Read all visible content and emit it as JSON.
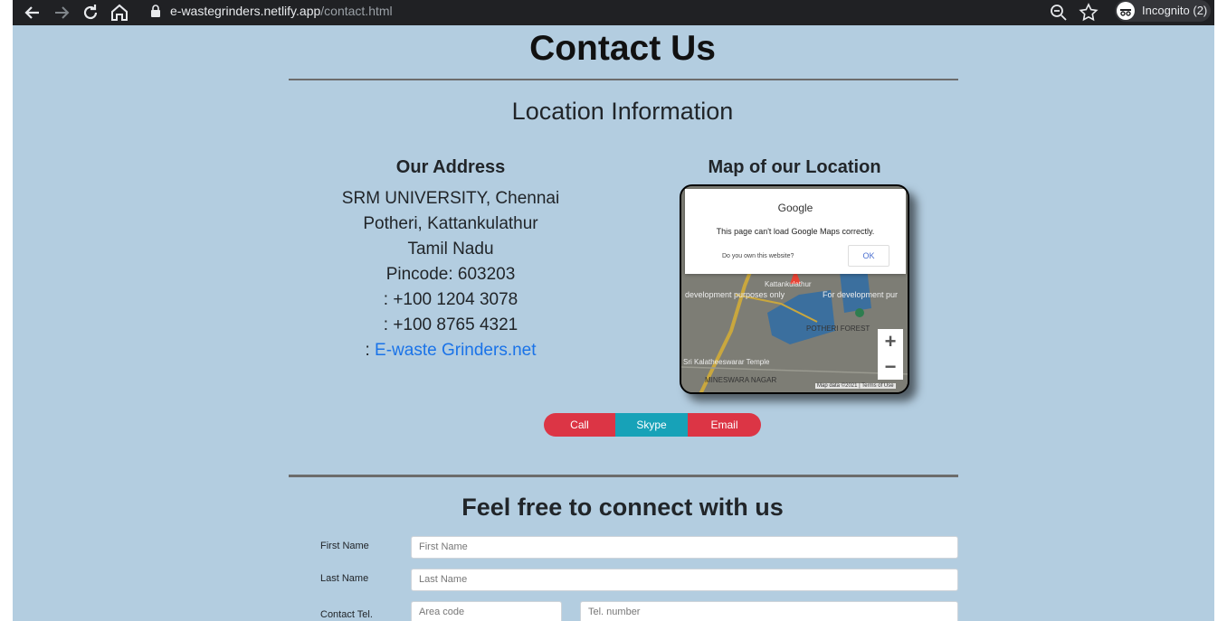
{
  "browser": {
    "url_host": "e-wastegrinders.netlify.app",
    "url_path": "/contact.html",
    "incognito_label": "Incognito (2)"
  },
  "page": {
    "title": "Contact Us",
    "location_heading": "Location Information",
    "address": {
      "title": "Our Address",
      "line1": "SRM UNIVERSITY, Chennai",
      "line2": "Potheri, Kattankulathur",
      "line3": "Tamil Nadu",
      "line4": "Pincode: 603203",
      "phone1": ": +100 1204 3078",
      "phone2": ": +100 8765 4321",
      "web_prefix": ": ",
      "web_link": "E-waste Grinders.net"
    },
    "map": {
      "title": "Map of our Location",
      "dialog_brand": "Google",
      "dialog_message": "This page can't load Google Maps correctly.",
      "dialog_question": "Do you own this website?",
      "dialog_ok": "OK",
      "zoom_in": "+",
      "zoom_out": "−",
      "labels": {
        "kattankulathur": "Kattankulathur",
        "dev_purposes": "development purposes only",
        "for_dev": "For development pur",
        "potheri_forest": "POTHERI FOREST",
        "temple": "Sri Kalatheeswarar Temple",
        "nagar": "MINESWARA NAGAR",
        "map_data": "Map data ©2021",
        "terms": "Terms of Use"
      }
    },
    "buttons": {
      "call": "Call",
      "skype": "Skype",
      "email": "Email"
    },
    "form": {
      "heading": "Feel free to connect with us",
      "first_name_label": "First Name",
      "first_name_placeholder": "First Name",
      "last_name_label": "Last Name",
      "last_name_placeholder": "Last Name",
      "contact_label": "Contact Tel.",
      "area_code_placeholder": "Area code",
      "tel_number_placeholder": "Tel. number"
    }
  },
  "colors": {
    "page_bg": "#b3cde0",
    "toolbar_bg": "#202124",
    "danger": "#dc3545",
    "info": "#17a2b8",
    "link": "#1a73e8"
  }
}
